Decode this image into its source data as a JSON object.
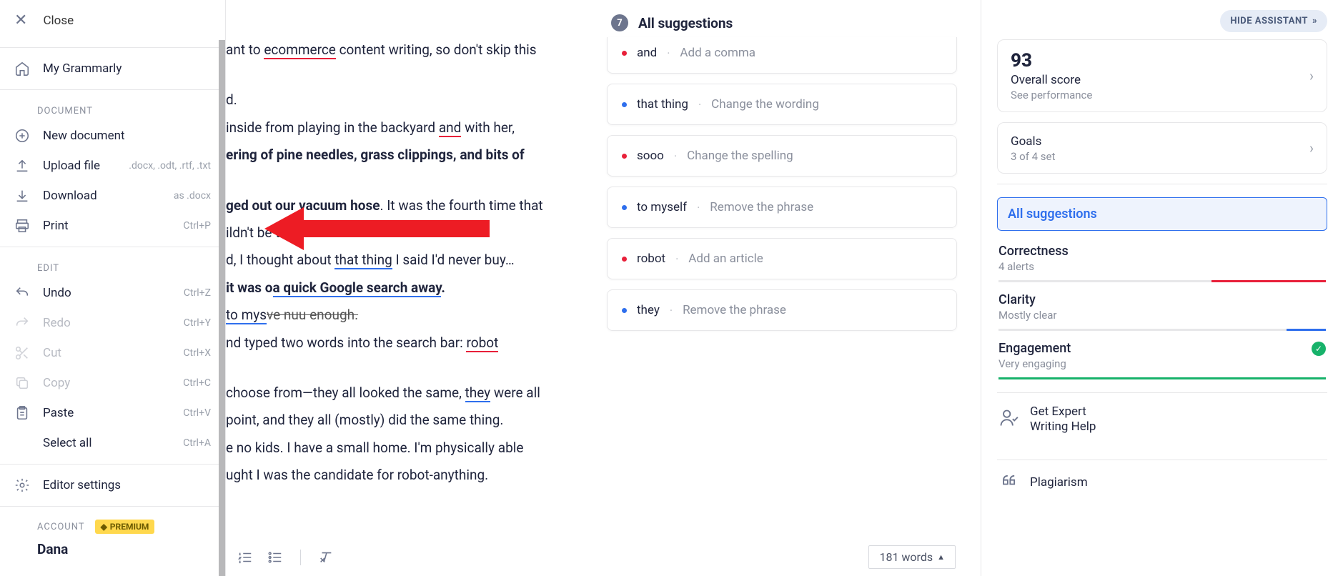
{
  "sidebar": {
    "close": "Close",
    "my_grammarly": "My Grammarly",
    "section_document": "DOCUMENT",
    "new_document": "New document",
    "upload_file": "Upload file",
    "upload_hint": ".docx, .odt, .rtf, .txt",
    "download": "Download",
    "download_hint": "as .docx",
    "print": "Print",
    "print_hint": "Ctrl+P",
    "section_edit": "EDIT",
    "undo": "Undo",
    "undo_hint": "Ctrl+Z",
    "redo": "Redo",
    "redo_hint": "Ctrl+Y",
    "cut": "Cut",
    "cut_hint": "Ctrl+X",
    "copy": "Copy",
    "copy_hint": "Ctrl+C",
    "paste": "Paste",
    "paste_hint": "Ctrl+V",
    "select_all": "Select all",
    "select_all_hint": "Ctrl+A",
    "editor_settings": "Editor settings",
    "section_account": "ACCOUNT",
    "premium": "PREMIUM",
    "user": "Dana"
  },
  "doc": {
    "l1a": "ant to ",
    "l1_ecom": "ecommerce",
    "l1b": " content writing, so don't skip this",
    "l2": "d.",
    "l3a": " inside from playing in the backyard ",
    "l3_and": "and",
    "l3b": " with her,",
    "l4": "ering of pine needles, grass clippings, and bits of",
    "l5a": "ged out our vacuum hose",
    "l5b": ". It was the fourth time that",
    "l6": "ildn't be the last.",
    "l7a": "d, I thought about ",
    "l7_thing": "that thing",
    "l7b": " I said I'd never buy…",
    "l8a": "it was o",
    "l8b": "a quick Google search away",
    "l8c": ".",
    "l9a": "to mys",
    "l9b": "ve nuu enough.",
    "l10a": "nd typed two words into the search bar: ",
    "l10_robot": "robot",
    "l11a": "choose from—they all looked the same, ",
    "l11_they": "they",
    "l11b": " were all",
    "l12": "point, and they all (mostly) did the same thing.",
    "l13": "e no kids. I have a small home. I'm physically able",
    "l14": "ught I was the candidate for robot-anything."
  },
  "footer": {
    "word_count": "181 words"
  },
  "suggestions": {
    "count": "7",
    "title": "All suggestions",
    "items": [
      {
        "word": "and",
        "action": "Add a comma",
        "color": "red"
      },
      {
        "word": "that thing",
        "action": "Change the wording",
        "color": "blue"
      },
      {
        "word": "sooo",
        "action": "Change the spelling",
        "color": "red"
      },
      {
        "word": "to myself",
        "action": "Remove the phrase",
        "color": "blue"
      },
      {
        "word": "robot",
        "action": "Add an article",
        "color": "red"
      },
      {
        "word": "they",
        "action": "Remove the phrase",
        "color": "blue"
      }
    ]
  },
  "panel": {
    "hide": "HIDE ASSISTANT",
    "score": "93",
    "score_title": "Overall score",
    "score_sub": "See performance",
    "goals_title": "Goals",
    "goals_sub": "3 of 4 set",
    "filter_all": "All suggestions",
    "correctness_title": "Correctness",
    "correctness_sub": "4 alerts",
    "clarity_title": "Clarity",
    "clarity_sub": "Mostly clear",
    "engagement_title": "Engagement",
    "engagement_sub": "Very engaging",
    "expert_l1": "Get Expert",
    "expert_l2": "Writing Help",
    "plagiarism": "Plagiarism"
  },
  "colors": {
    "red": "#e8203a",
    "blue": "#2f6fed",
    "green": "#17b26a"
  }
}
